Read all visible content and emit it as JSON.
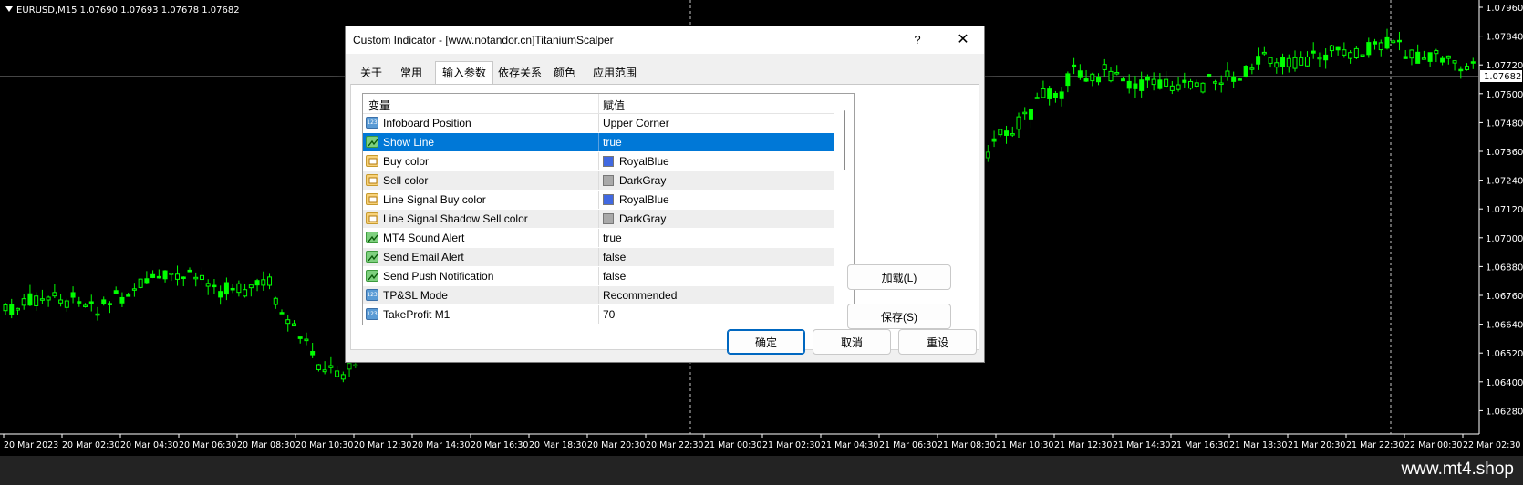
{
  "chart": {
    "info": "EURUSD,M15  1.07690 1.07693 1.07678 1.07682",
    "current_price": "1.07682",
    "price_labels": [
      "1.07960",
      "1.07840",
      "1.07720",
      "1.07600",
      "1.07480",
      "1.07360",
      "1.07240",
      "1.07120",
      "1.07000",
      "1.06880",
      "1.06760",
      "1.06640",
      "1.06520",
      "1.06400",
      "1.06280"
    ],
    "time_labels": [
      "20 Mar 2023",
      "20 Mar 02:30",
      "20 Mar 04:30",
      "20 Mar 06:30",
      "20 Mar 08:30",
      "20 Mar 10:30",
      "20 Mar 12:30",
      "20 Mar 14:30",
      "20 Mar 16:30",
      "20 Mar 18:30",
      "20 Mar 20:30",
      "20 Mar 22:30",
      "21 Mar 00:30",
      "21 Mar 02:30",
      "21 Mar 04:30",
      "21 Mar 06:30",
      "21 Mar 08:30",
      "21 Mar 10:30",
      "21 Mar 12:30",
      "21 Mar 14:30",
      "21 Mar 16:30",
      "21 Mar 18:30",
      "21 Mar 20:30",
      "21 Mar 22:30",
      "22 Mar 00:30",
      "22 Mar 02:30"
    ],
    "candle_color": "#00ff00",
    "background": "#000000"
  },
  "watermark": "www.mt4.shop",
  "dialog": {
    "title": "Custom Indicator - [www.notandor.cn]TitaniumScalper",
    "help": "?",
    "close": "✕",
    "tabs": [
      "关于",
      "常用",
      "输入参数",
      "依存关系",
      "颜色",
      "应用范围"
    ],
    "active_tab": "输入参数",
    "grid": {
      "col_variable": "变量",
      "col_value": "赋值",
      "rows": [
        {
          "icon": "numeric-icon",
          "name": "Infoboard Position",
          "value": "Upper Corner"
        },
        {
          "icon": "boolean-icon",
          "name": "Show Line",
          "value": "true",
          "selected": true
        },
        {
          "icon": "color-icon",
          "name": "Buy color",
          "value": "RoyalBlue",
          "swatch": "#4169e1"
        },
        {
          "icon": "color-icon",
          "name": "Sell color",
          "value": "DarkGray",
          "swatch": "#a9a9a9"
        },
        {
          "icon": "color-icon",
          "name": "Line Signal Buy color",
          "value": "RoyalBlue",
          "swatch": "#4169e1"
        },
        {
          "icon": "color-icon",
          "name": "Line Signal Shadow Sell color",
          "value": "DarkGray",
          "swatch": "#a9a9a9"
        },
        {
          "icon": "boolean-icon",
          "name": "MT4 Sound Alert",
          "value": "true"
        },
        {
          "icon": "boolean-icon",
          "name": "Send Email Alert",
          "value": "false"
        },
        {
          "icon": "boolean-icon",
          "name": "Send Push Notification",
          "value": "false"
        },
        {
          "icon": "numeric-icon",
          "name": "TP&SL Mode",
          "value": "Recommended"
        },
        {
          "icon": "numeric-icon",
          "name": "TakeProfit M1",
          "value": "70"
        }
      ]
    },
    "buttons": {
      "load": "加载(L)",
      "save": "保存(S)",
      "ok": "确定",
      "cancel": "取消",
      "reset": "重设"
    }
  }
}
